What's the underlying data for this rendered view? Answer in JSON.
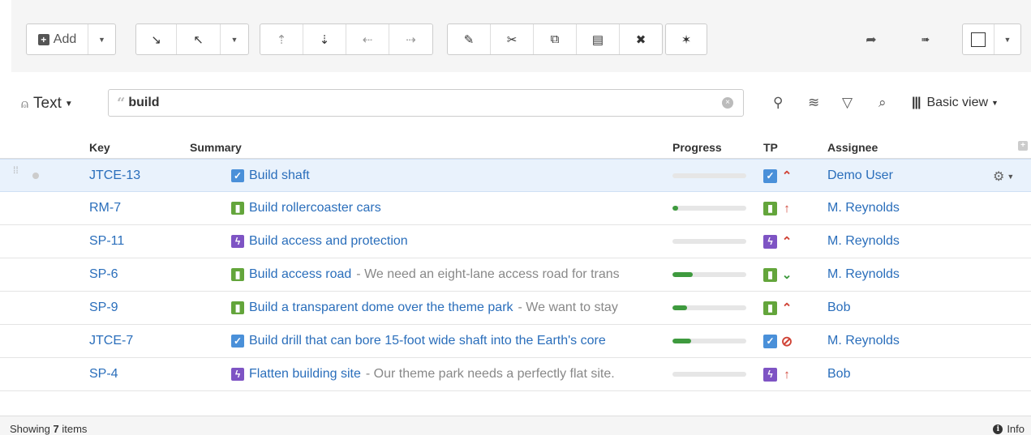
{
  "toolbar": {
    "add_label": "Add",
    "icons": {
      "expand": "↘",
      "collapse": "↖",
      "move_up": "⇡",
      "move_down": "⇣",
      "outdent": "⇠",
      "indent": "⇢",
      "edit": "✎",
      "cut": "✂",
      "copy": "⧉",
      "paste": "▤",
      "delete": "✖",
      "magic": "✶",
      "share": "➦",
      "export": "➠"
    }
  },
  "search": {
    "mode_label": "Text",
    "query": "build",
    "view_label": "Basic view"
  },
  "columns": {
    "key": "Key",
    "summary": "Summary",
    "progress": "Progress",
    "tp": "TP",
    "assignee": "Assignee"
  },
  "rows": [
    {
      "key": "JTCE-13",
      "type": "task",
      "summary": "Build shaft",
      "description": "",
      "progress": 0.0,
      "priority": "highest",
      "assignee": "Demo User",
      "selected": true
    },
    {
      "key": "RM-7",
      "type": "story",
      "summary": "Build rollercoaster cars",
      "description": "",
      "progress": 0.08,
      "priority": "high",
      "assignee": "M. Reynolds",
      "selected": false
    },
    {
      "key": "SP-11",
      "type": "epic",
      "summary": "Build access and protection",
      "description": "",
      "progress": 0.0,
      "priority": "highest",
      "assignee": "M. Reynolds",
      "selected": false
    },
    {
      "key": "SP-6",
      "type": "story",
      "summary": "Build access road",
      "description": "We need an eight-lane access road for trans",
      "progress": 0.28,
      "priority": "low",
      "assignee": "M. Reynolds",
      "selected": false
    },
    {
      "key": "SP-9",
      "type": "story",
      "summary": "Build a transparent dome over the theme park",
      "description": "We want to stay",
      "progress": 0.2,
      "priority": "highest",
      "assignee": "Bob",
      "selected": false
    },
    {
      "key": "JTCE-7",
      "type": "task",
      "summary": "Build drill that can bore 15-foot wide shaft into the Earth's core",
      "description": "",
      "progress": 0.25,
      "priority": "blocker",
      "assignee": "M. Reynolds",
      "selected": false
    },
    {
      "key": "SP-4",
      "type": "epic",
      "summary": "Flatten building site",
      "description": "Our theme park needs a perfectly flat site.",
      "progress": 0.0,
      "priority": "high",
      "assignee": "Bob",
      "selected": false
    }
  ],
  "status": {
    "showing_prefix": "Showing",
    "count": "7",
    "showing_suffix": "items",
    "info_label": "Info"
  },
  "colors": {
    "link": "#2a6ebb",
    "task": "#4a90d9",
    "story": "#63a53b",
    "epic": "#7e54c4",
    "progress_fill": "#3e9a3e",
    "priority_high": "#d04437",
    "priority_low": "#3e9a3e",
    "selected_row": "#e9f2fc"
  }
}
